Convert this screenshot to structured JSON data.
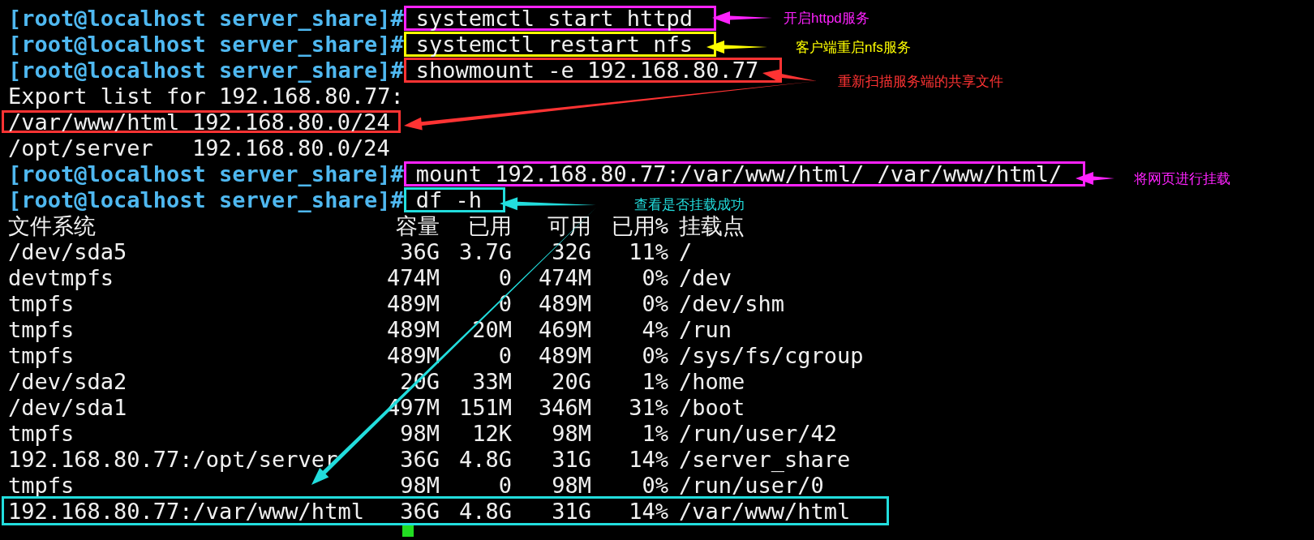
{
  "terminal": {
    "lines": [
      {
        "kind": "command",
        "prompt": "[root@localhost server_share]#",
        "command": "systemctl start httpd",
        "color": "#ff22ff"
      },
      {
        "kind": "command",
        "prompt": "[root@localhost server_share]#",
        "command": "systemctl restart nfs",
        "color": "#ffff00"
      },
      {
        "kind": "command",
        "prompt": "[root@localhost server_share]#",
        "command": "showmount -e 192.168.80.77",
        "color": "#ff3333"
      },
      {
        "kind": "text",
        "text": "Export list for 192.168.80.77:"
      },
      {
        "kind": "export",
        "path": "/var/www/html",
        "clients": "192.168.80.0/24",
        "color": "#ff3333"
      },
      {
        "kind": "export",
        "path": "/opt/server",
        "clients": "192.168.80.0/24"
      },
      {
        "kind": "command",
        "prompt": "[root@localhost server_share]#",
        "command": "mount 192.168.80.77:/var/www/html/ /var/www/html/",
        "color": "#ff22ff"
      },
      {
        "kind": "command",
        "prompt": "[root@localhost server_share]#",
        "command": "df -h",
        "color": "#22dddd"
      },
      {
        "kind": "df",
        "cells": [
          "文件系统",
          "容量",
          "已用",
          "可用",
          "已用%",
          "挂载点"
        ]
      },
      {
        "kind": "df",
        "cells": [
          "/dev/sda5",
          "36G",
          "3.7G",
          "32G",
          "11%",
          "/"
        ]
      },
      {
        "kind": "df",
        "cells": [
          "devtmpfs",
          "474M",
          "0",
          "474M",
          "0%",
          "/dev"
        ]
      },
      {
        "kind": "df",
        "cells": [
          "tmpfs",
          "489M",
          "0",
          "489M",
          "0%",
          "/dev/shm"
        ]
      },
      {
        "kind": "df",
        "cells": [
          "tmpfs",
          "489M",
          "20M",
          "469M",
          "4%",
          "/run"
        ]
      },
      {
        "kind": "df",
        "cells": [
          "tmpfs",
          "489M",
          "0",
          "489M",
          "0%",
          "/sys/fs/cgroup"
        ]
      },
      {
        "kind": "df",
        "cells": [
          "/dev/sda2",
          "20G",
          "33M",
          "20G",
          "1%",
          "/home"
        ]
      },
      {
        "kind": "df",
        "cells": [
          "/dev/sda1",
          "497M",
          "151M",
          "346M",
          "31%",
          "/boot"
        ]
      },
      {
        "kind": "df",
        "cells": [
          "tmpfs",
          "98M",
          "12K",
          "98M",
          "1%",
          "/run/user/42"
        ]
      },
      {
        "kind": "df",
        "cells": [
          "192.168.80.77:/opt/server",
          "36G",
          "4.8G",
          "31G",
          "14%",
          "/server_share"
        ]
      },
      {
        "kind": "df",
        "cells": [
          "tmpfs",
          "98M",
          "0",
          "98M",
          "0%",
          "/run/user/0"
        ]
      },
      {
        "kind": "df",
        "cells": [
          "192.168.80.77:/var/www/html",
          "36G",
          "4.8G",
          "31G",
          "14%",
          "/var/www/html"
        ],
        "color": "#22dddd"
      }
    ]
  },
  "annotations": [
    {
      "text": "开启httpd服务",
      "color": "#ff22ff"
    },
    {
      "text": "客户端重启nfs服务",
      "color": "#ffff00"
    },
    {
      "text": "重新扫描服务端的共享文件",
      "color": "#ff3333"
    },
    {
      "text": "将网页进行挂载",
      "color": "#ff22ff"
    },
    {
      "text": "查看是否挂载成功",
      "color": "#22dddd"
    }
  ]
}
